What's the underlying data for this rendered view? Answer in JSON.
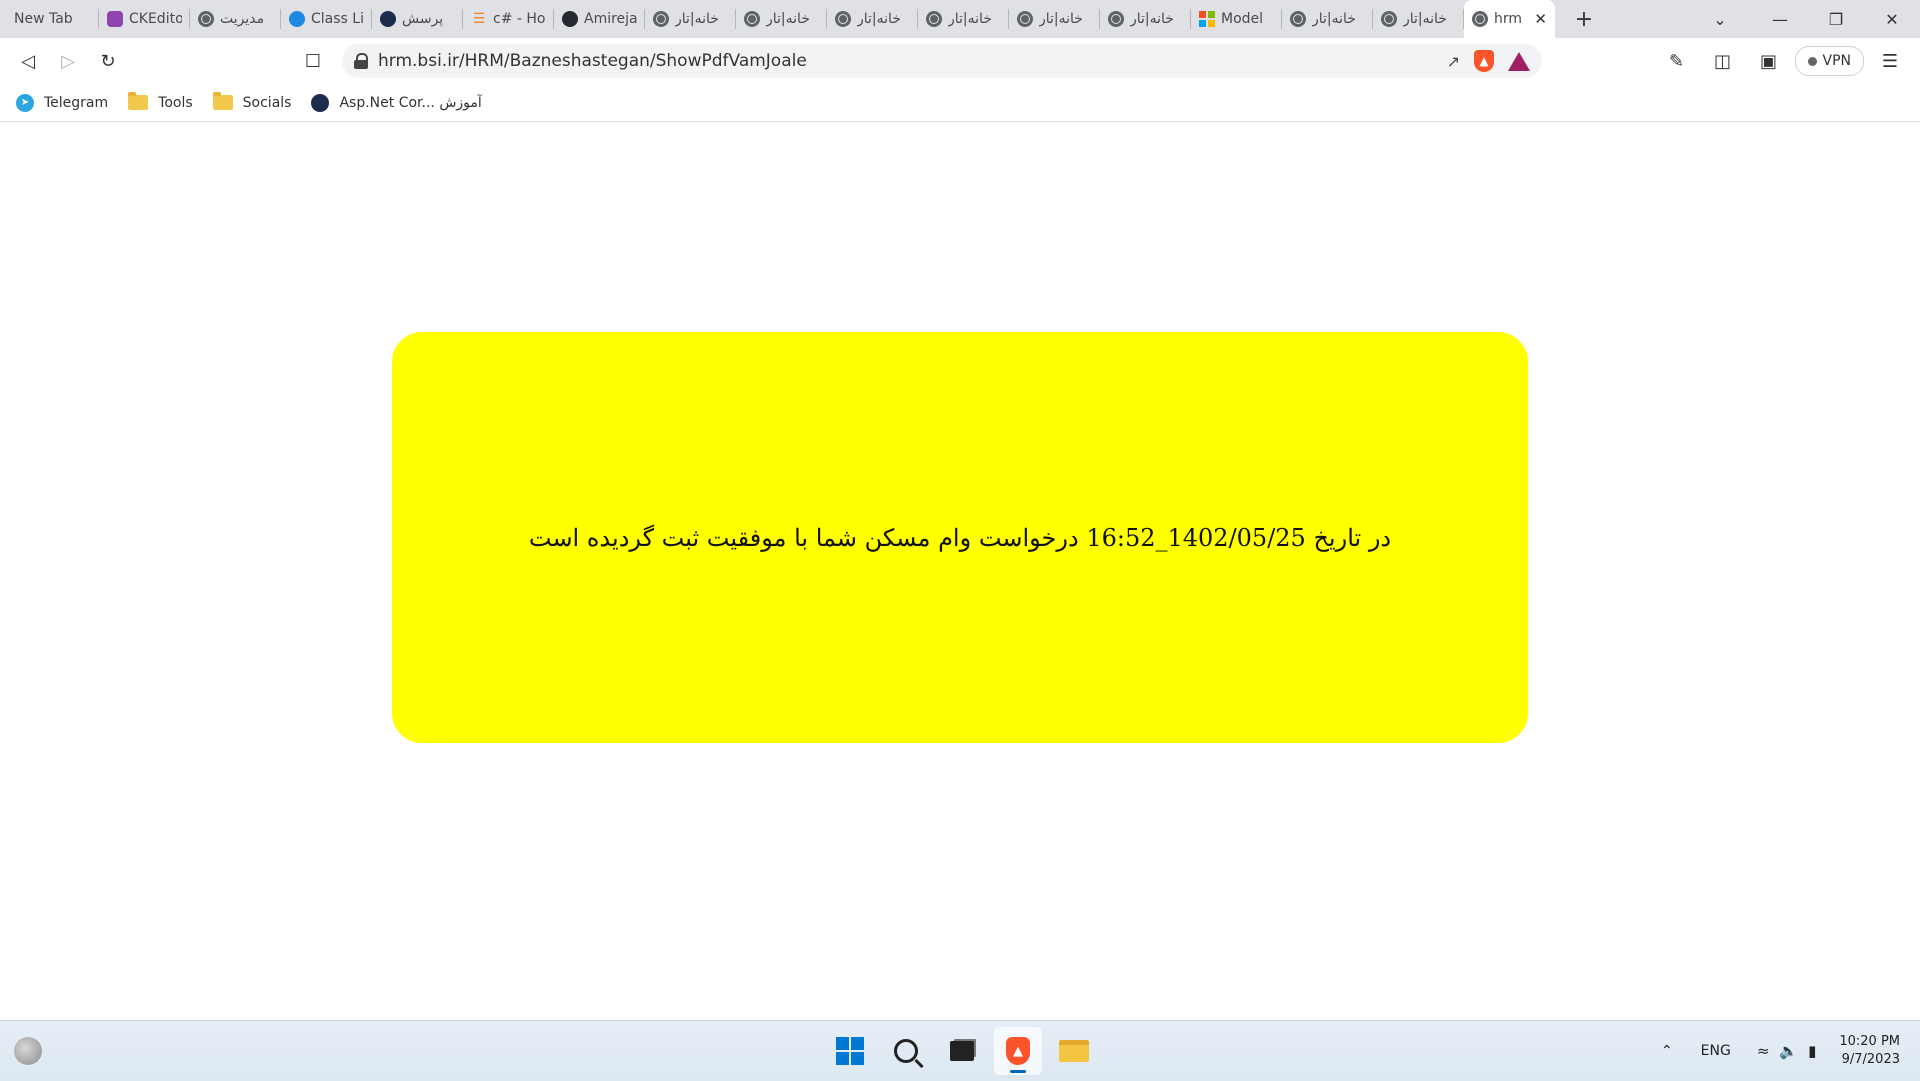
{
  "tabs": [
    {
      "title": "New Tab",
      "icon": "none"
    },
    {
      "title": "CKEditor",
      "icon": "ckeditor-icon"
    },
    {
      "title": "مدیریت",
      "icon": "globe-icon"
    },
    {
      "title": "Class Li",
      "icon": "blue-favicon-icon"
    },
    {
      "title": "پرسش",
      "icon": "navy-favicon-icon"
    },
    {
      "title": "c# - Ho",
      "icon": "stackoverflow-icon"
    },
    {
      "title": "Amireja",
      "icon": "github-icon"
    },
    {
      "title": "خانه|تار",
      "icon": "globe-icon"
    },
    {
      "title": "خانه|تار",
      "icon": "globe-icon"
    },
    {
      "title": "خانه|تار",
      "icon": "globe-icon"
    },
    {
      "title": "خانه|تار",
      "icon": "globe-icon"
    },
    {
      "title": "خانه|تار",
      "icon": "globe-icon"
    },
    {
      "title": "خانه|تار",
      "icon": "globe-icon"
    },
    {
      "title": "Model",
      "icon": "microsoft-icon"
    },
    {
      "title": "خانه|تار",
      "icon": "globe-icon"
    },
    {
      "title": "خانه|تار",
      "icon": "globe-icon"
    }
  ],
  "active_tab": {
    "title": "hrm",
    "icon": "globe-icon"
  },
  "toolbar": {
    "url": "hrm.bsi.ir/HRM/Bazneshastegan/ShowPdfVamJoale",
    "vpn_label": "VPN"
  },
  "bookmarks": [
    {
      "label": "Telegram",
      "icon": "telegram-icon"
    },
    {
      "label": "Tools",
      "icon": "folder-icon"
    },
    {
      "label": "Socials",
      "icon": "folder-icon"
    },
    {
      "label": "Asp.Net Cor... آموزش",
      "icon": "navy-favicon-icon"
    }
  ],
  "page": {
    "message": "در تاریخ 1402/05/25_16:52 درخواست وام مسکن شما با موفقیت ثبت گردیده است",
    "box_color": "#ffff00"
  },
  "taskbar": {
    "language": "ENG",
    "time": "10:20 PM",
    "date": "9/7/2023"
  }
}
